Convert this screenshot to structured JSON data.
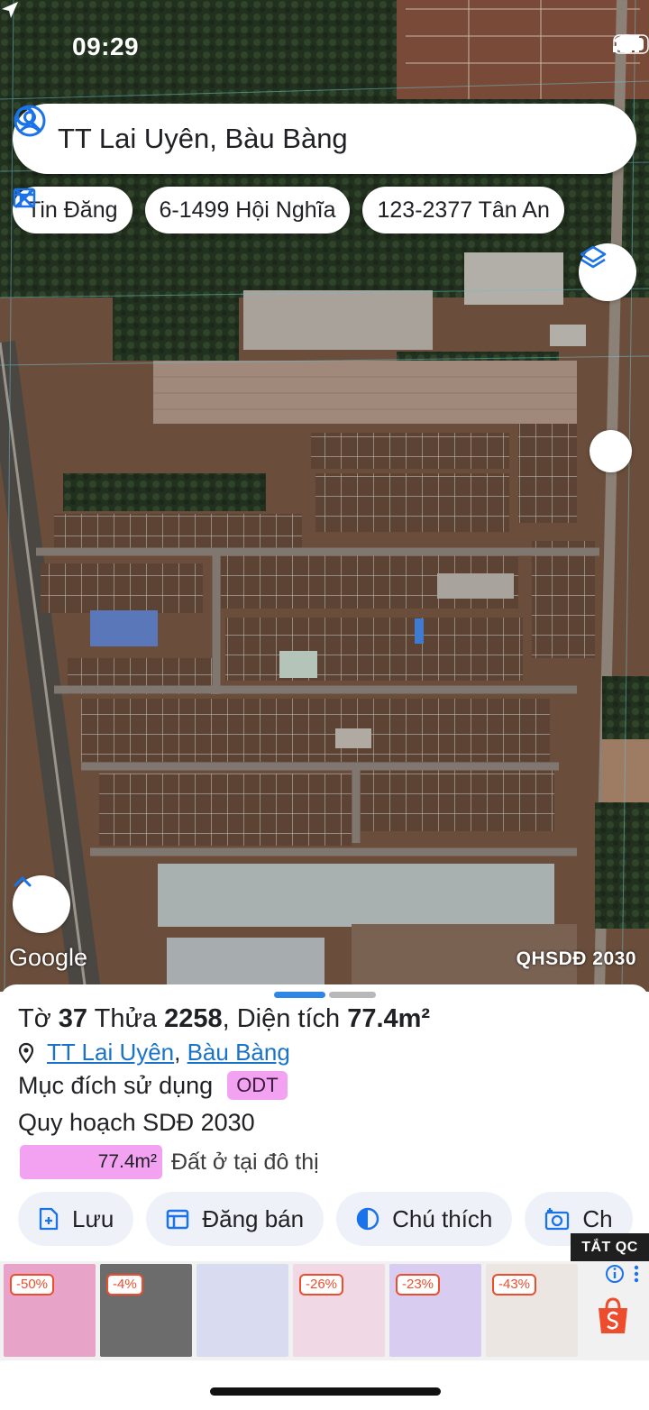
{
  "status_bar": {
    "time": "09:29"
  },
  "search": {
    "query": "TT Lai Uyên, Bàu Bàng"
  },
  "chips": [
    {
      "label": "Tin Đăng",
      "icon": "calendar-icon"
    },
    {
      "label": "6-1499 Hội Nghĩa",
      "icon": ""
    },
    {
      "label": "123-2377 Tân An",
      "icon": "ruler-cross-icon"
    }
  ],
  "map": {
    "attribution": "Google",
    "layer_label": "QHSDĐ 2030"
  },
  "parcel": {
    "sheet_label": "Tờ",
    "sheet_no": "37",
    "parcel_label": "Thửa",
    "parcel_no": "2258",
    "area_label": ", Diện tích",
    "area": "77.4m²",
    "ward": "TT Lai Uyên",
    "district": "Bàu Bàng",
    "purpose_label": "Mục đích sử dụng",
    "purpose_code": "ODT",
    "plan_label": "Quy hoạch SDĐ 2030",
    "land_area": "77.4m²",
    "land_type": "Đất ở tại đô thị",
    "land_color": "#f3a2f2"
  },
  "actions": [
    {
      "label": "Lưu",
      "icon": "add-document-icon"
    },
    {
      "label": "Đăng bán",
      "icon": "calendar-icon"
    },
    {
      "label": "Chú thích",
      "icon": "contrast-icon"
    },
    {
      "label": "Ch",
      "icon": "camera-add-icon"
    }
  ],
  "ad": {
    "tag": "TẮT QC",
    "items": [
      {
        "discount": "-50%",
        "color": "#e8a3c8"
      },
      {
        "discount": "-4%",
        "color": "#6c6c6c"
      },
      {
        "discount": "",
        "color": "#d9dcf0"
      },
      {
        "discount": "-26%",
        "color": "#f0d9e4"
      },
      {
        "discount": "-23%",
        "color": "#d8ccf0"
      },
      {
        "discount": "-43%",
        "color": "#ece6e2"
      }
    ],
    "brand_color": "#ee4d2d"
  }
}
